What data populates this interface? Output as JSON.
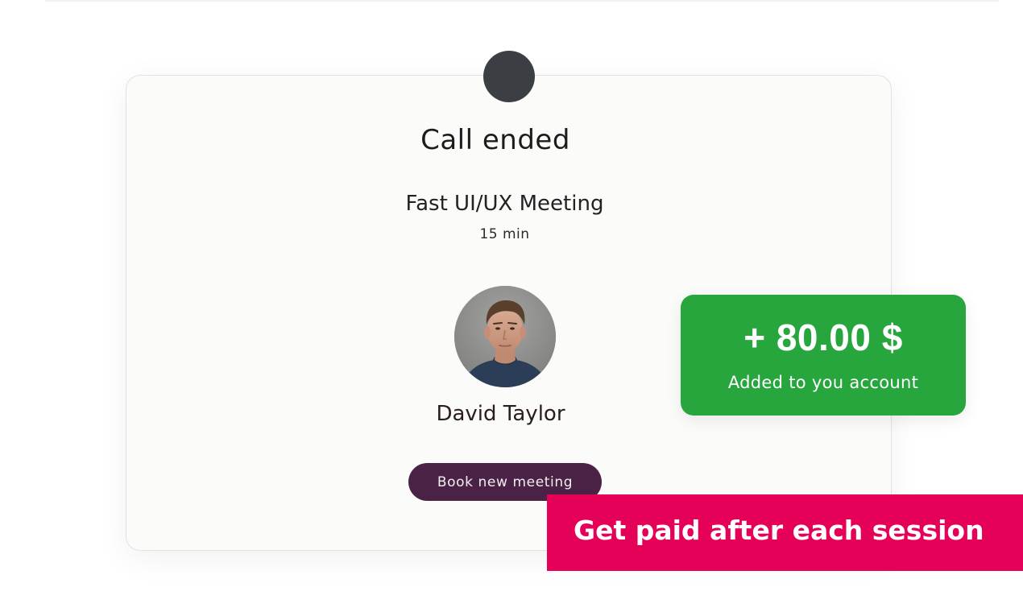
{
  "call_card": {
    "title": "Call ended",
    "meeting_name": "Fast UI/UX Meeting",
    "duration": "15 min",
    "participant_name": "David Taylor",
    "book_button_label": "Book new meeting"
  },
  "payout": {
    "amount": "+ 80.00 $",
    "note": "Added to you account"
  },
  "banner": {
    "text": "Get paid after each session"
  },
  "colors": {
    "card_background": "#fbfbfa",
    "top_dot": "#3b3e42",
    "book_button": "#4a2245",
    "payout_background": "#27a63e",
    "banner_background": "#e50058"
  }
}
